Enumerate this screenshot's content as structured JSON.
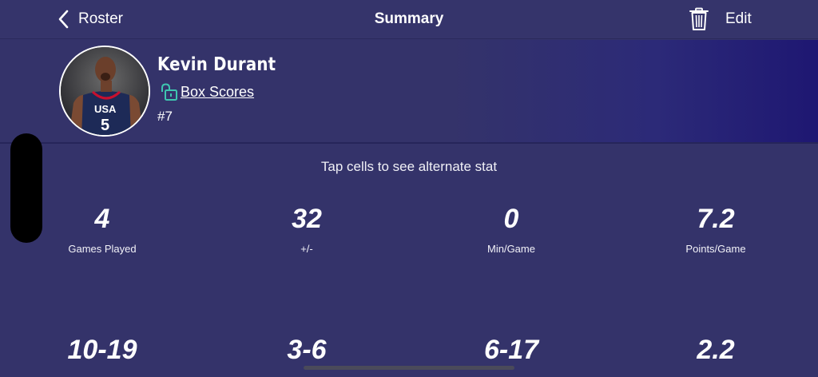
{
  "nav": {
    "back_label": "Roster",
    "title": "Summary",
    "edit_label": "Edit",
    "back_icon": "chevron-left-icon",
    "trash_icon": "trash-icon"
  },
  "player": {
    "name": "Kevin Durant",
    "box_scores_label": "Box Scores",
    "box_scores_icon": "unlock-icon",
    "jersey": "#7",
    "jersey_on_photo_text": "USA",
    "jersey_number_on_photo": "5"
  },
  "hint": "Tap cells to see alternate stat",
  "stats_row1": [
    {
      "value": "4",
      "label": "Games Played"
    },
    {
      "value": "32",
      "label": "+/-"
    },
    {
      "value": "0",
      "label": "Min/Game"
    },
    {
      "value": "7.2",
      "label": "Points/Game"
    }
  ],
  "stats_row2": [
    {
      "value": "10-19",
      "label": ""
    },
    {
      "value": "3-6",
      "label": ""
    },
    {
      "value": "6-17",
      "label": ""
    },
    {
      "value": "2.2",
      "label": ""
    }
  ],
  "colors": {
    "background": "#34336a",
    "header_gradient_end": "#1e1772",
    "unlock_icon": "#3ec6b0"
  }
}
